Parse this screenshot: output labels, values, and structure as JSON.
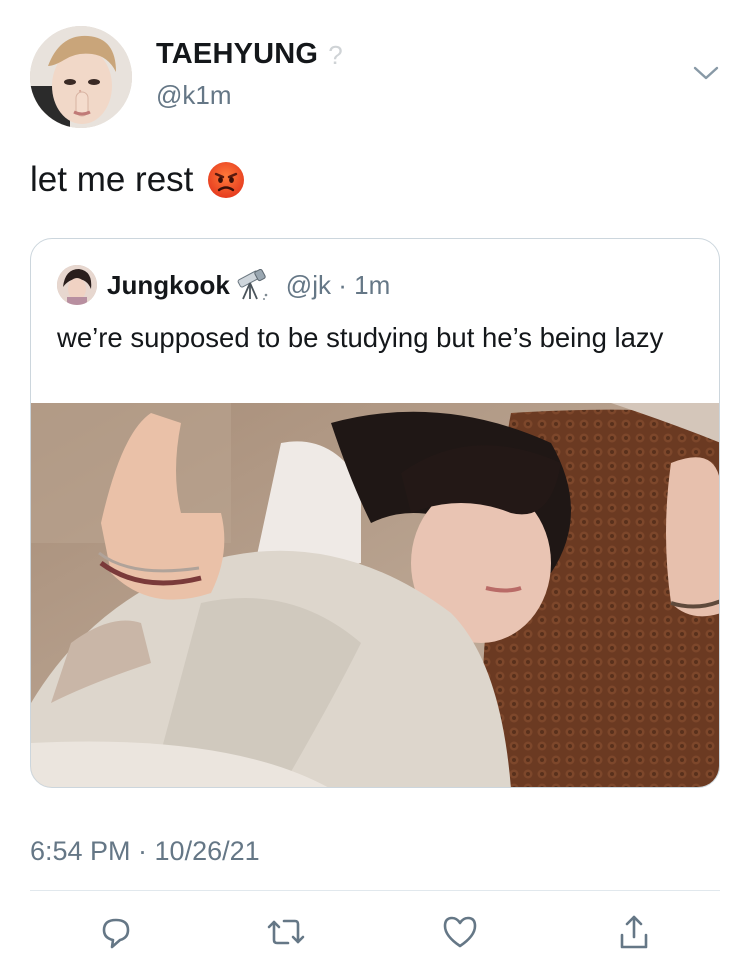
{
  "author": {
    "display_name": "TAEHYUNG",
    "badge": "?",
    "handle": "@k1m"
  },
  "tweet": {
    "text": "let me rest",
    "emoji_icon": "angry-face-icon"
  },
  "quoted_tweet": {
    "display_name": "Jungkook",
    "name_emoji_icon": "telescope-icon",
    "handle": "@jk",
    "separator": "·",
    "time": "1m",
    "text": "we’re supposed to be studying but he’s being lazy"
  },
  "meta": {
    "timestamp": "6:54 PM · 10/26/21"
  },
  "actions": {
    "reply_icon": "reply-icon",
    "retweet_icon": "retweet-icon",
    "like_icon": "heart-icon",
    "share_icon": "share-icon"
  },
  "colors": {
    "primary_text": "#14171a",
    "secondary_text": "#657786",
    "border": "#ccd6dd",
    "divider": "#e1e8ed"
  }
}
